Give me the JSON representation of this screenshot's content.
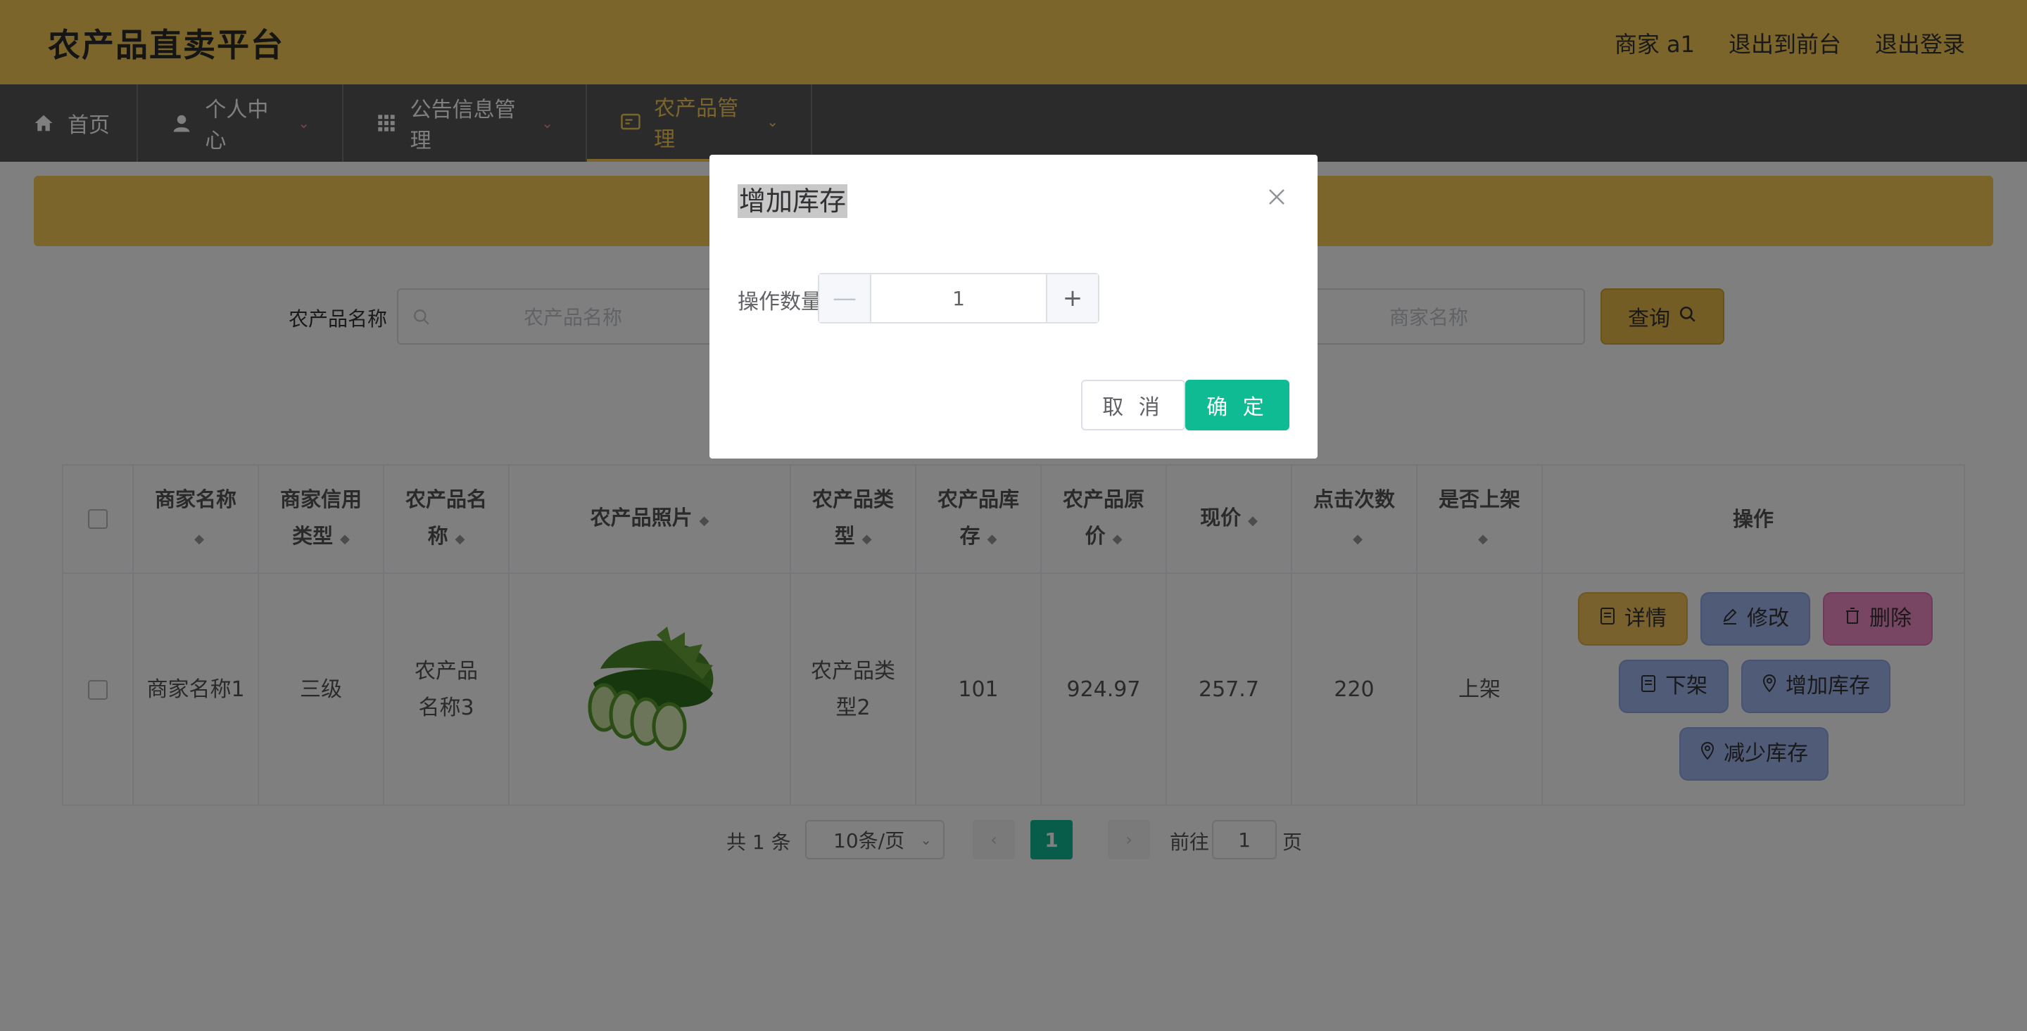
{
  "header": {
    "brand": "农产品直卖平台",
    "user": "商家 a1",
    "to_front": "退出到前台",
    "logout": "退出登录"
  },
  "nav": {
    "items": [
      {
        "label": "首页",
        "icon": "home-icon"
      },
      {
        "label": "个人中心",
        "icon": "user-icon"
      },
      {
        "label": "公告信息管理",
        "icon": "grid-icon"
      },
      {
        "label": "农产品管理",
        "icon": "card-icon"
      }
    ]
  },
  "search": {
    "label": "农产品名称",
    "placeholder1": "农产品名称",
    "placeholder2": "商家名称",
    "query_label": "查询"
  },
  "table": {
    "headers": [
      "商家名称",
      "商家信用类型",
      "农产品名称",
      "农产品照片",
      "农产品类型",
      "农产品库存",
      "农产品原价",
      "现价",
      "点击次数",
      "是否上架",
      "操作"
    ],
    "rows": [
      {
        "merchant": "商家名称1",
        "credit": "三级",
        "name": "农产品名称3",
        "type": "农产品类型2",
        "stock": "101",
        "original_price": "924.97",
        "price": "257.7",
        "clicks": "220",
        "on_shelf": "上架"
      }
    ],
    "actions": {
      "detail": "详情",
      "edit": "修改",
      "delete": "删除",
      "off_shelf": "下架",
      "add_stock": "增加库存",
      "reduce_stock": "减少库存"
    }
  },
  "pager": {
    "total": "共 1 条",
    "page_size": "10条/页",
    "current": "1",
    "goto": "前往",
    "goto_value": "1",
    "page_suffix": "页"
  },
  "dialog": {
    "title": "增加库存",
    "label": "操作数量",
    "value": "1",
    "cancel": "取 消",
    "confirm": "确 定"
  },
  "colors": {
    "header": "#f7ca57",
    "nav": "#585758",
    "primary": "#0fbb92"
  }
}
